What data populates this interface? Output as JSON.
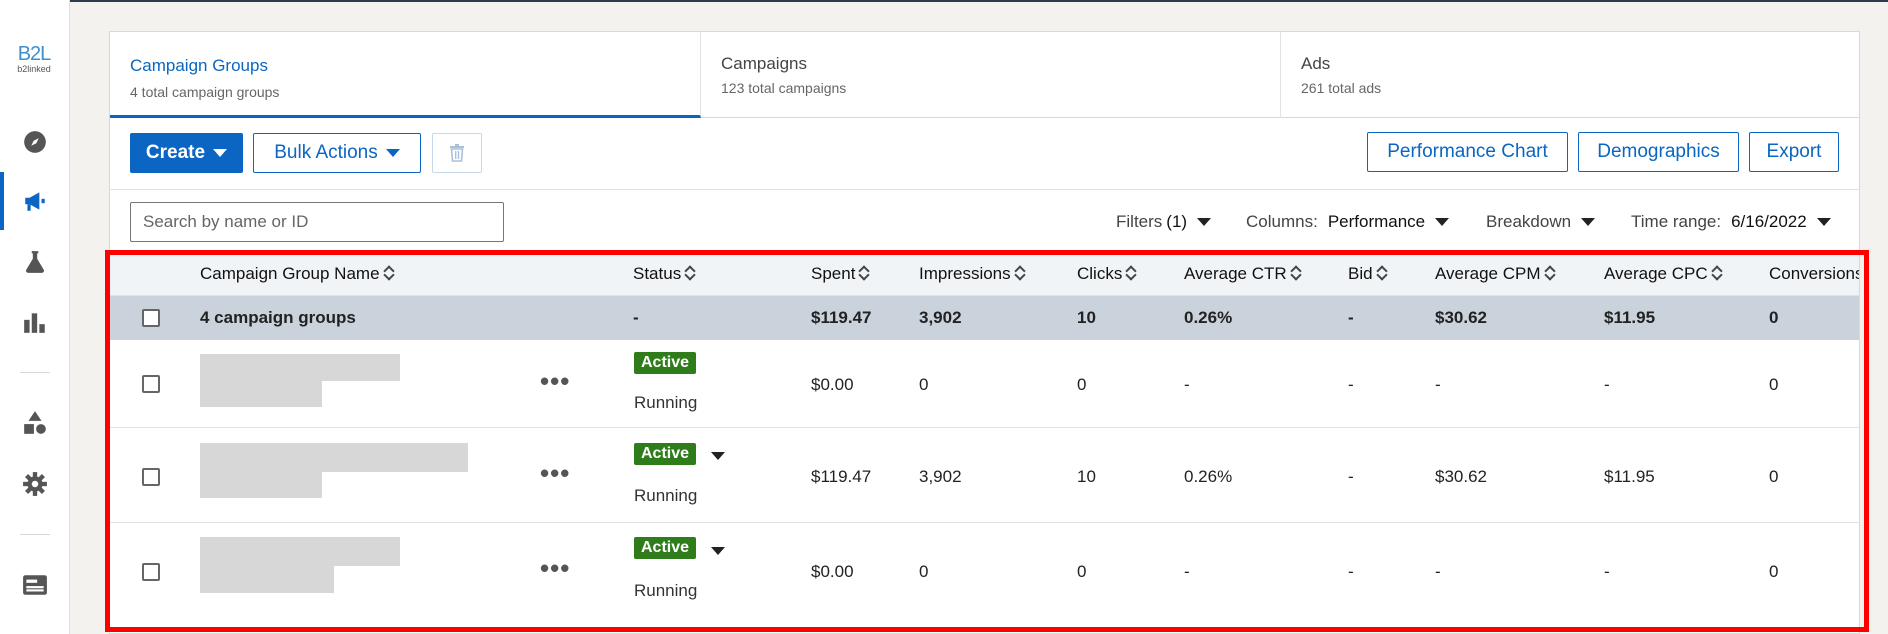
{
  "rail": {
    "logo_mark": "B2L",
    "logo_word": "b2linked",
    "icons": [
      "compass-icon",
      "megaphone-icon",
      "flask-icon",
      "bar-chart-icon",
      "shapes-icon",
      "gear-icon",
      "id-card-icon"
    ]
  },
  "tabs": [
    {
      "title": "Campaign Groups",
      "subtitle": "4 total campaign groups"
    },
    {
      "title": "Campaigns",
      "subtitle": "123 total campaigns"
    },
    {
      "title": "Ads",
      "subtitle": "261 total ads"
    }
  ],
  "toolbar": {
    "create_label": "Create",
    "bulk_label": "Bulk Actions",
    "perf_chart_label": "Performance Chart",
    "demographics_label": "Demographics",
    "export_label": "Export"
  },
  "filters": {
    "search_placeholder": "Search by name or ID",
    "filters_label": "Filters",
    "filters_count": "(1)",
    "columns_label": "Columns:",
    "columns_value": "Performance",
    "breakdown_label": "Breakdown",
    "time_label": "Time range:",
    "time_value": "6/16/2022"
  },
  "table": {
    "headers": [
      "Campaign Group Name",
      "Status",
      "Spent",
      "Impressions",
      "Clicks",
      "Average CTR",
      "Bid",
      "Average CPM",
      "Average CPC",
      "Conversions"
    ],
    "summary": {
      "name": "4 campaign groups",
      "status": "-",
      "spent": "$119.47",
      "impressions": "3,902",
      "clicks": "10",
      "ctr": "0.26%",
      "bid": "-",
      "cpm": "$30.62",
      "cpc": "$11.95",
      "conversions": "0"
    },
    "rows": [
      {
        "status_badge": "Active",
        "status_sub": "Running",
        "spent": "$0.00",
        "impressions": "0",
        "clicks": "0",
        "ctr": "-",
        "bid": "-",
        "cpm": "-",
        "cpc": "-",
        "conversions": "0"
      },
      {
        "status_badge": "Active",
        "status_sub": "Running",
        "spent": "$119.47",
        "impressions": "3,902",
        "clicks": "10",
        "ctr": "0.26%",
        "bid": "-",
        "cpm": "$30.62",
        "cpc": "$11.95",
        "conversions": "0"
      },
      {
        "status_badge": "Active",
        "status_sub": "Running",
        "spent": "$0.00",
        "impressions": "0",
        "clicks": "0",
        "ctr": "-",
        "bid": "-",
        "cpm": "-",
        "cpc": "-",
        "conversions": "0"
      }
    ],
    "more_glyph": "•••"
  },
  "colors": {
    "accent": "#0a66c2",
    "active_badge": "#2f7d1a",
    "highlight_box": "#ff0000"
  }
}
